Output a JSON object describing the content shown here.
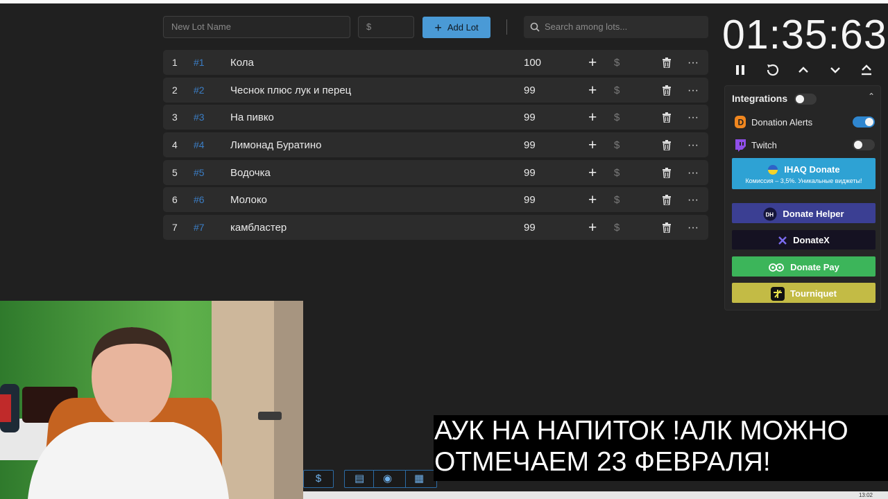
{
  "toolbar": {
    "lot_name_placeholder": "New Lot Name",
    "lot_price_placeholder": "$",
    "add_lot_label": "Add Lot",
    "search_placeholder": "Search among lots..."
  },
  "lots": [
    {
      "index": "1",
      "tag": "#1",
      "name": "Кола",
      "amount": "100"
    },
    {
      "index": "2",
      "tag": "#2",
      "name": "Чеснок плюс лук и перец",
      "amount": "99"
    },
    {
      "index": "3",
      "tag": "#3",
      "name": "На пивко",
      "amount": "99"
    },
    {
      "index": "4",
      "tag": "#4",
      "name": "Лимонад Буратино",
      "amount": "99"
    },
    {
      "index": "5",
      "tag": "#5",
      "name": "Водочка",
      "amount": "99"
    },
    {
      "index": "6",
      "tag": "#6",
      "name": "Молоко",
      "amount": "99"
    },
    {
      "index": "7",
      "tag": "#7",
      "name": "камбластер",
      "amount": "99"
    }
  ],
  "row_actions": {
    "plus": "+",
    "dollar": "$",
    "more": "···"
  },
  "timer": {
    "value": "01:35:63"
  },
  "integrations": {
    "title": "Integrations",
    "enabled": false,
    "donation_alerts": {
      "label": "Donation Alerts",
      "enabled": true
    },
    "twitch": {
      "label": "Twitch",
      "enabled": false
    },
    "ihaq": {
      "label": "IHAQ Donate",
      "sub": "Комиссия – 3,5%. Уникальные виджеты!"
    },
    "donate_helper": {
      "label": "Donate Helper",
      "icon_text": "DH"
    },
    "donatex": {
      "label": "DonateX"
    },
    "donate_pay": {
      "label": "Donate Pay"
    },
    "tourniquet": {
      "label": "Tourniquet"
    }
  },
  "bottom_bar": {
    "dollar": "$"
  },
  "taskbar": {
    "clock": "13:02"
  },
  "caption": {
    "line1": "АУК НА НАПИТОК !АЛК МОЖНО",
    "line2": "ОТМЕЧАЕМ 23 ФЕВРАЛЯ!"
  },
  "colors": {
    "accent": "#4a9ad6",
    "tag": "#3b7dc4",
    "ihaq": "#2ea2d4",
    "donate_helper": "#3b3f93",
    "donatex": "#151222",
    "donate_pay": "#3cb55a",
    "tourniquet": "#c3bb45"
  }
}
